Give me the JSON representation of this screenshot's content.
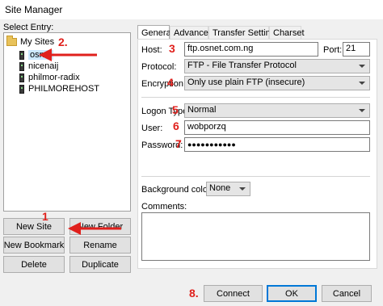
{
  "window": {
    "title": "Site Manager"
  },
  "left": {
    "select_entry_label": "Select Entry:",
    "tree": {
      "root": "My Sites",
      "sites": [
        "osnet",
        "nicenaij",
        "philmor-radix",
        "PHILMOREHOST"
      ]
    },
    "buttons": {
      "new_site": "New Site",
      "new_folder": "New Folder",
      "new_bookmark": "New Bookmark",
      "rename": "Rename",
      "delete": "Delete",
      "duplicate": "Duplicate"
    }
  },
  "tabs": [
    "General",
    "Advanced",
    "Transfer Settings",
    "Charset"
  ],
  "general": {
    "host_label": "Host:",
    "host_value": "ftp.osnet.com.ng",
    "port_label": "Port:",
    "port_value": "21",
    "protocol_label": "Protocol:",
    "protocol_value": "FTP - File Transfer Protocol",
    "encryption_label": "Encryption:",
    "encryption_value": "Only use plain FTP (insecure)",
    "logon_label": "Logon Type:",
    "logon_value": "Normal",
    "user_label": "User:",
    "user_value": "wobporzq",
    "password_label": "Password:",
    "password_value": "●●●●●●●●●●●",
    "bgcolor_label": "Background color:",
    "bgcolor_value": "None",
    "comments_label": "Comments:"
  },
  "footer": {
    "connect": "Connect",
    "ok": "OK",
    "cancel": "Cancel"
  },
  "annotations": {
    "n1": "1",
    "n2": "2.",
    "n3": "3",
    "n4": "4",
    "n5": "5",
    "n6": "6",
    "n7": "7",
    "n8": "8."
  },
  "colors": {
    "annotation": "#e0201c",
    "selection": "#cce8ff",
    "accent": "#0078d7"
  }
}
